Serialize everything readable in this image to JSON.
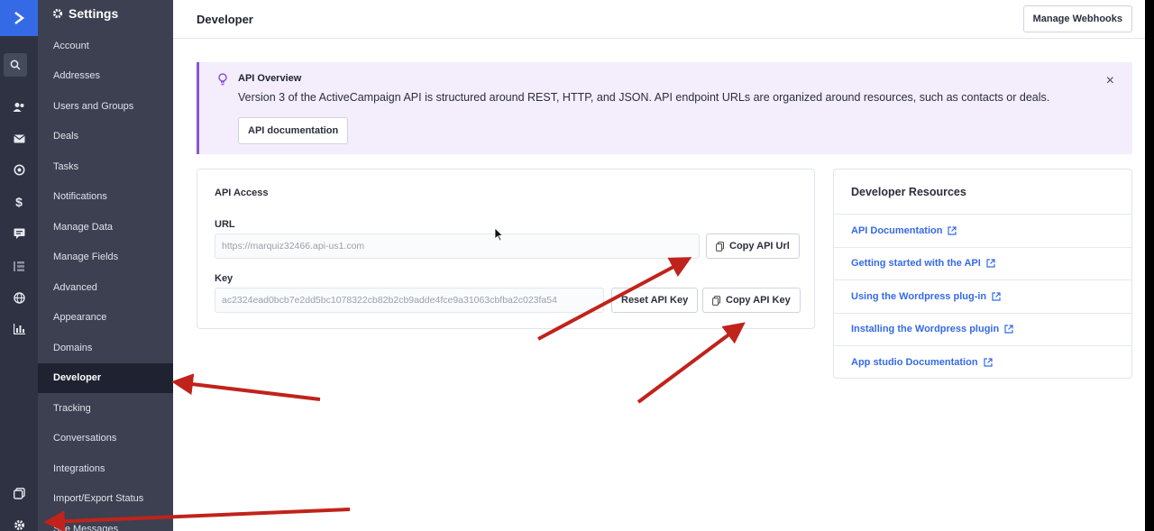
{
  "rail": {
    "icons": [
      "chevron-right-logo-icon",
      "search-icon",
      "contacts-icon",
      "mail-icon",
      "target-icon",
      "dollar-icon",
      "chat-icon",
      "list-icon",
      "globe-icon",
      "reports-icon",
      "pages-icon",
      "gear-icon"
    ]
  },
  "nav": {
    "header": "Settings",
    "items": [
      {
        "label": "Account"
      },
      {
        "label": "Addresses"
      },
      {
        "label": "Users and Groups"
      },
      {
        "label": "Deals"
      },
      {
        "label": "Tasks"
      },
      {
        "label": "Notifications"
      },
      {
        "label": "Manage Data"
      },
      {
        "label": "Manage Fields"
      },
      {
        "label": "Advanced"
      },
      {
        "label": "Appearance"
      },
      {
        "label": "Domains"
      },
      {
        "label": "Developer"
      },
      {
        "label": "Tracking"
      },
      {
        "label": "Conversations"
      },
      {
        "label": "Integrations"
      },
      {
        "label": "Import/Export Status"
      },
      {
        "label": "Site Messages"
      }
    ],
    "active": "Developer"
  },
  "topbar": {
    "title": "Developer",
    "webhooks_label": "Manage Webhooks"
  },
  "banner": {
    "title": "API Overview",
    "text": "Version 3 of the ActiveCampaign API is structured around REST, HTTP, and JSON. API endpoint URLs are organized around resources, such as contacts or deals.",
    "doc_button": "API documentation",
    "close": "×",
    "accent": "#8a57d8"
  },
  "api_access": {
    "title": "API Access",
    "url_label": "URL",
    "url_value": "https://marquiz32466.api-us1.com",
    "copy_url": "Copy API Url",
    "key_label": "Key",
    "key_value": "ac2324ead0bcb7e2dd5bc1078322cb82b2cb9adde4fce9a31063cbfba2c023fa54",
    "reset_key": "Reset API Key",
    "copy_key": "Copy API Key"
  },
  "resources": {
    "title": "Developer Resources",
    "links": [
      {
        "label": "API Documentation"
      },
      {
        "label": "Getting started with the API"
      },
      {
        "label": "Using the Wordpress plug-in"
      },
      {
        "label": "Installing the Wordpress plugin"
      },
      {
        "label": "App studio Documentation"
      }
    ],
    "link_color": "#356ae6"
  },
  "annotations": {
    "arrow_color": "#c0231b"
  }
}
